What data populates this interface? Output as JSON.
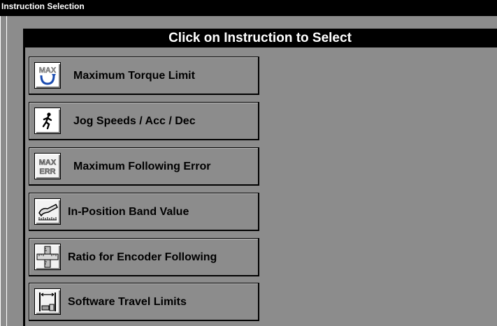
{
  "window": {
    "title": "Instruction Selection"
  },
  "panel": {
    "header": "Click on Instruction to Select"
  },
  "instructions": [
    {
      "label": "Maximum Torque Limit",
      "icon": "max-torque-icon"
    },
    {
      "label": "Jog Speeds / Acc / Dec",
      "icon": "jog-runner-icon"
    },
    {
      "label": "Maximum Following Error",
      "icon": "max-error-icon"
    },
    {
      "label": "In-Position Band Value",
      "icon": "in-position-band-icon"
    },
    {
      "label": "Ratio for Encoder Following",
      "icon": "encoder-ratio-icon"
    },
    {
      "label": "Software Travel Limits",
      "icon": "travel-limits-icon"
    }
  ],
  "colors": {
    "background": "#8c8c8c",
    "titlebar": "#000000",
    "text": "#000000"
  }
}
